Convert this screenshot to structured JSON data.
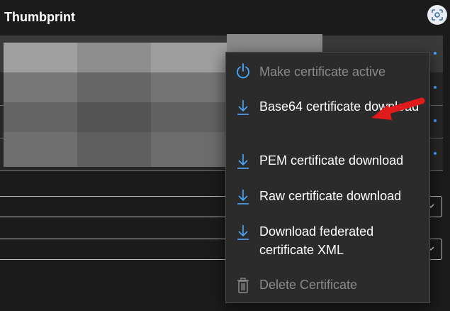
{
  "header": {
    "title": "Thumbprint"
  },
  "menu": {
    "items": [
      {
        "label": "Make certificate active",
        "icon": "power-icon",
        "enabled": false
      },
      {
        "label": "Base64 certificate download",
        "icon": "download-icon",
        "enabled": true
      },
      {
        "label": "PEM certificate download",
        "icon": "download-icon",
        "enabled": true
      },
      {
        "label": "Raw certificate download",
        "icon": "download-icon",
        "enabled": true
      },
      {
        "label": "Download federated certificate XML",
        "icon": "download-icon",
        "enabled": true
      },
      {
        "label": "Delete Certificate",
        "icon": "trash-icon",
        "enabled": false
      }
    ]
  },
  "colors": {
    "accent": "#4aa8ff",
    "menu_bg": "#2b2b2b",
    "disabled_text": "#8a8a8a",
    "annotation_arrow": "#e01b1b"
  }
}
